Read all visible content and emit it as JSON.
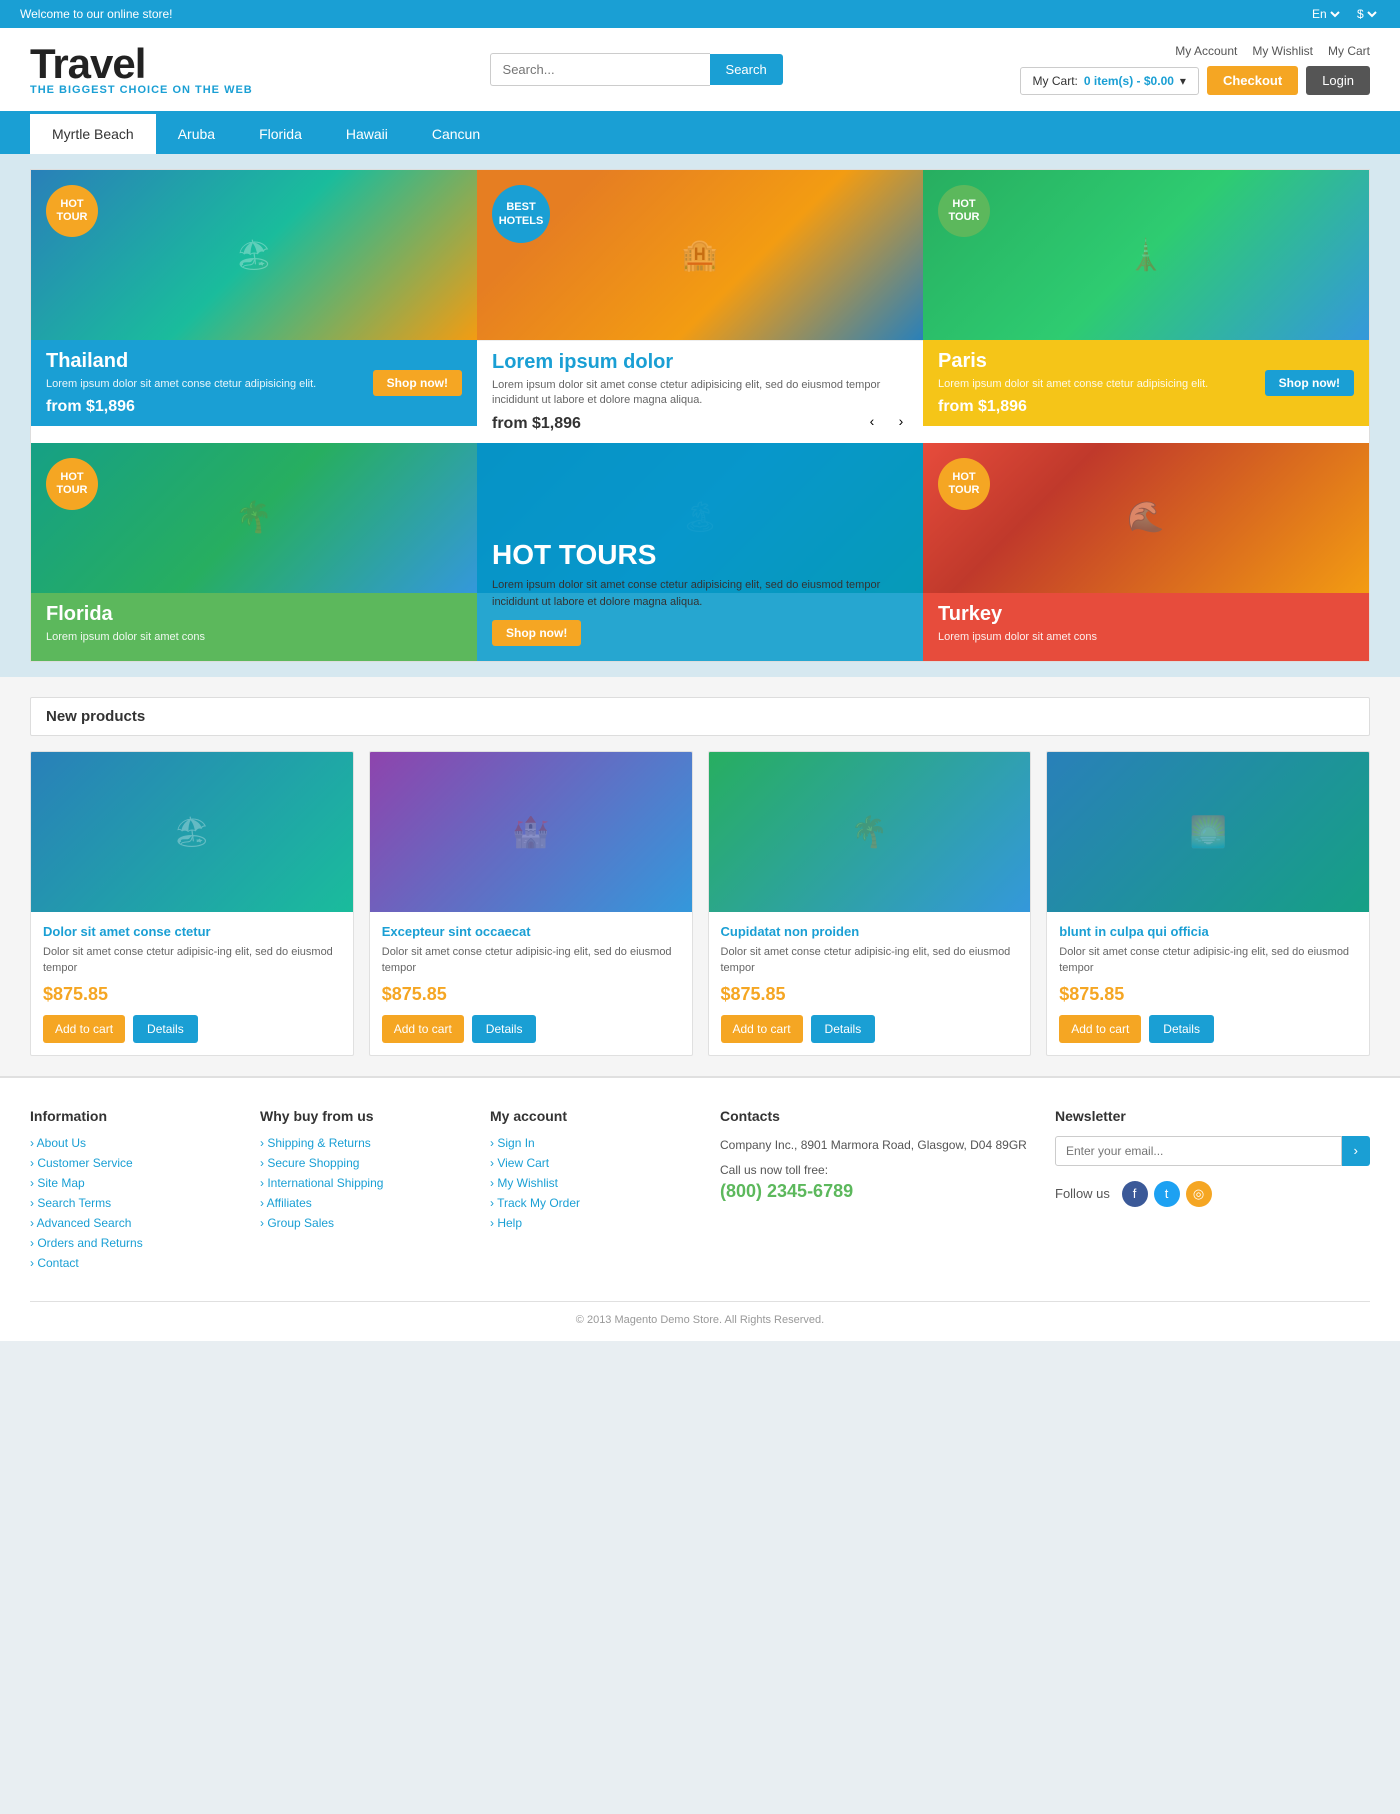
{
  "topbar": {
    "welcome": "Welcome to our online store!",
    "lang": "En",
    "currency": "$"
  },
  "header": {
    "logo_main": "Travel",
    "logo_sub": "THE BIGGEST CHOICE ON THE WEB",
    "search_placeholder": "Search...",
    "search_btn": "Search",
    "link_account": "My Account",
    "link_wishlist": "My Wishlist",
    "link_cart": "My Cart",
    "btn_checkout": "Checkout",
    "btn_login": "Login",
    "cart_label": "My Cart:",
    "cart_items": "0 item(s) - $0.00"
  },
  "nav": {
    "tabs": [
      "Myrtle Beach",
      "Aruba",
      "Florida",
      "Hawaii",
      "Cancun"
    ],
    "active": 0
  },
  "hero": {
    "card1": {
      "badge": "HOT\nTOUR",
      "title": "Thailand",
      "desc": "Lorem ipsum dolor sit amet conse ctetur adipisicing elit.",
      "price": "from $1,896",
      "btn": "Shop now!"
    },
    "card2": {
      "badge": "BEST\nHOTELS",
      "title": "Lorem ipsum dolor",
      "desc": "Lorem ipsum dolor sit amet conse ctetur adipisicing elit, sed do eiusmod tempor incididunt ut labore et dolore magna aliqua.",
      "price": "from $1,896",
      "btn": "Shop now!"
    },
    "card3": {
      "badge": "HOT\nTOUR",
      "title": "Paris",
      "desc": "Lorem ipsum dolor sit amet conse ctetur adipisicing elit.",
      "price": "from $1,896",
      "btn": "Shop now!"
    },
    "card4": {
      "badge": "HOT\nTOUR",
      "title": "Florida",
      "desc": "Lorem ipsum dolor sit amet cons"
    },
    "card5": {
      "title": "HOT TOURS",
      "desc": "Lorem ipsum dolor sit amet conse ctetur adipisicing elit, sed do eiusmod tempor incididunt ut labore et dolore magna aliqua.",
      "btn": "Shop now!"
    },
    "card6": {
      "badge": "HOT\nTOUR",
      "title": "Turkey",
      "desc": "Lorem ipsum dolor sit amet cons"
    }
  },
  "products": {
    "section_title": "New products",
    "items": [
      {
        "name": "Dolor sit amet conse ctetur",
        "desc": "Dolor sit amet conse ctetur adipisic-ing elit, sed do eiusmod tempor",
        "price": "$875.85",
        "btn_cart": "Add to cart",
        "btn_details": "Details"
      },
      {
        "name": "Excepteur sint occaecat",
        "desc": "Dolor sit amet conse ctetur adipisic-ing elit, sed do eiusmod tempor",
        "price": "$875.85",
        "btn_cart": "Add to cart",
        "btn_details": "Details"
      },
      {
        "name": "Cupidatat non proiden",
        "desc": "Dolor sit amet conse ctetur adipisic-ing elit, sed do eiusmod tempor",
        "price": "$875.85",
        "btn_cart": "Add to cart",
        "btn_details": "Details"
      },
      {
        "name": "blunt in culpa qui officia",
        "desc": "Dolor sit amet conse ctetur adipisic-ing elit, sed do eiusmod tempor",
        "price": "$875.85",
        "btn_cart": "Add to cart",
        "btn_details": "Details"
      }
    ]
  },
  "footer": {
    "col1_title": "Information",
    "col1_links": [
      "About Us",
      "Customer Service",
      "Site Map",
      "Search Terms",
      "Advanced Search",
      "Orders and Returns",
      "Contact"
    ],
    "col2_title": "Why buy from us",
    "col2_links": [
      "Shipping & Returns",
      "Secure Shopping",
      "International Shipping",
      "Affiliates",
      "Group Sales"
    ],
    "col3_title": "My account",
    "col3_links": [
      "Sign In",
      "View Cart",
      "My Wishlist",
      "Track My Order",
      "Help"
    ],
    "col4_title": "Contacts",
    "col4_address": "Company Inc., 8901 Marmora Road, Glasgow, D04 89GR",
    "col4_call": "Call us now toll free:",
    "col4_phone": "(800) 2345-6789",
    "col5_title": "Newsletter",
    "newsletter_placeholder": "",
    "follow_label": "Follow us",
    "copyright": "© 2013 Magento Demo Store. All Rights Reserved."
  }
}
